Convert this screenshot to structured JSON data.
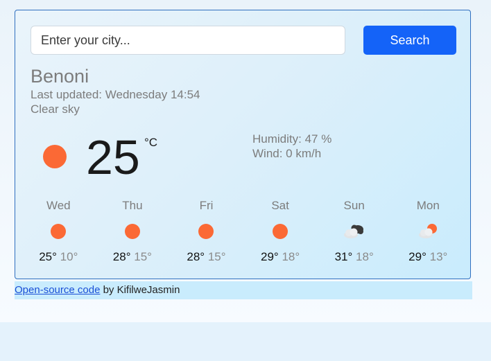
{
  "search": {
    "placeholder": "Enter your city...",
    "button_label": "Search"
  },
  "current": {
    "city": "Benoni",
    "last_updated": "Last updated: Wednesday 14:54",
    "description": "Clear sky",
    "icon": "clear-sky-icon",
    "temperature": "25",
    "unit": "°C",
    "humidity": "Humidity: 47 %",
    "wind": "Wind: 0 km/h"
  },
  "forecast": [
    {
      "day": "Wed",
      "icon": "clear-sky-icon",
      "max": "25°",
      "min": "10°"
    },
    {
      "day": "Thu",
      "icon": "clear-sky-icon",
      "max": "28°",
      "min": "15°"
    },
    {
      "day": "Fri",
      "icon": "clear-sky-icon",
      "max": "28°",
      "min": "15°"
    },
    {
      "day": "Sat",
      "icon": "clear-sky-icon",
      "max": "29°",
      "min": "18°"
    },
    {
      "day": "Sun",
      "icon": "broken-clouds-icon",
      "max": "31°",
      "min": "18°"
    },
    {
      "day": "Mon",
      "icon": "few-clouds-icon",
      "max": "29°",
      "min": "13°"
    }
  ],
  "footer": {
    "link_text": "Open-source code",
    "by_text": " by KifilweJasmin"
  },
  "colors": {
    "accent": "#1463f8",
    "sun": "#fb6935",
    "card_border": "#2f6fbf"
  }
}
